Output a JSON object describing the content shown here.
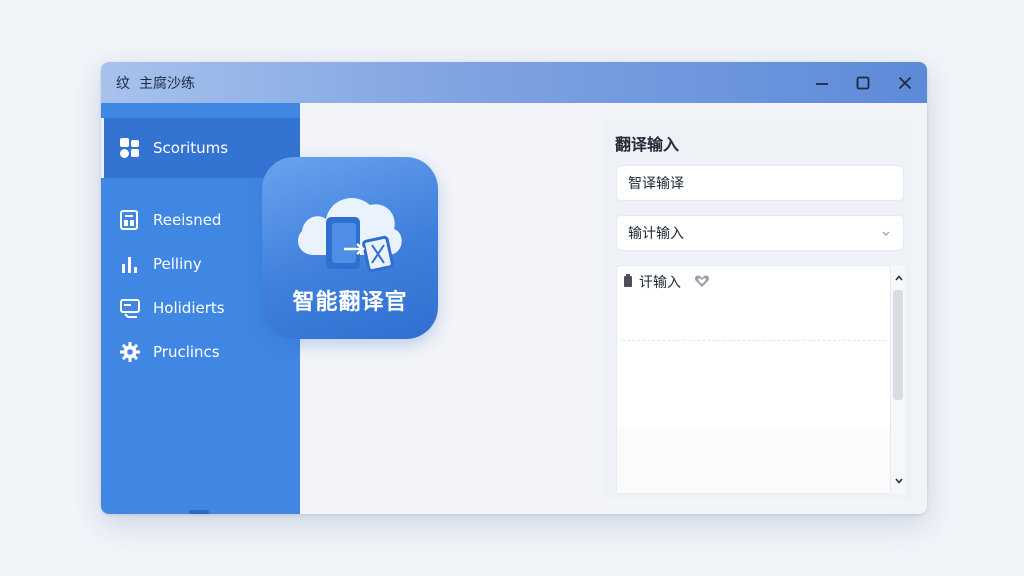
{
  "window": {
    "title_icon": "纹",
    "title": "主腐沙练",
    "controls": [
      "minimize-icon",
      "maximize-icon",
      "close-icon"
    ]
  },
  "sidebar": {
    "items": [
      {
        "label": "Scoritums",
        "icon": "apps-icon",
        "active": true,
        "expandable": false
      },
      {
        "label": "Reeisned",
        "icon": "document-grid-icon",
        "active": false,
        "expandable": true
      },
      {
        "label": "Pelliny",
        "icon": "bar-chart-icon",
        "active": false,
        "expandable": true
      },
      {
        "label": "Holidierts",
        "icon": "card-icon",
        "active": false,
        "expandable": false
      },
      {
        "label": "Pruclincs",
        "icon": "gear-icon",
        "active": false,
        "expandable": false
      }
    ]
  },
  "logo": {
    "text": "智能翻译官",
    "icon": "cloud-document-translate-icon"
  },
  "panel": {
    "title": "翻译输入",
    "input_value": "智译输译",
    "select_value": "输计输入",
    "textarea_text": "讦输入"
  },
  "colors": {
    "sidebar": "#3f87e2",
    "sidebar_active": "#3374d2",
    "accent": "#3f80dd",
    "titlebar_end": "#5d8ad8"
  }
}
